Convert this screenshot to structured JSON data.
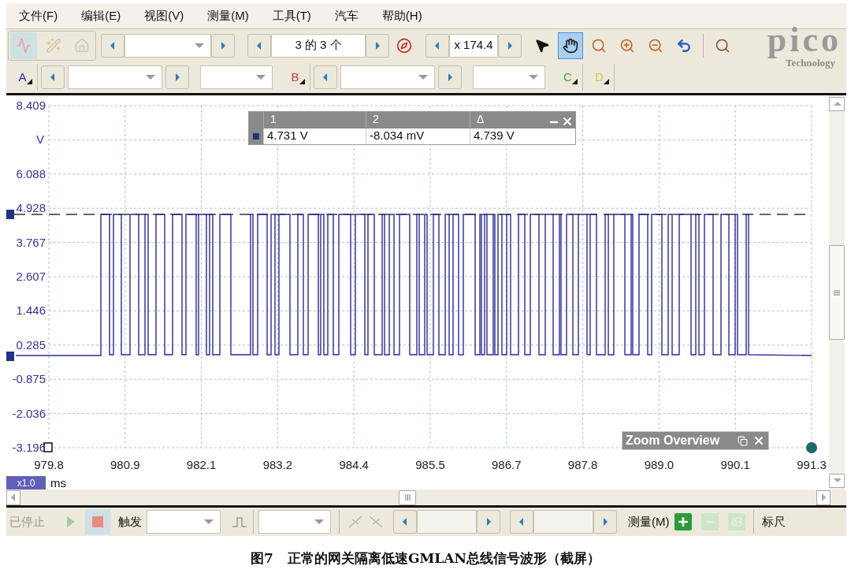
{
  "menu": [
    "文件(F)",
    "编辑(E)",
    "视图(V)",
    "测量(M)",
    "工具(T)",
    "汽车",
    "帮助(H)"
  ],
  "toolbar": {
    "page_counter": "3 的 3 个",
    "zoom_factor": "x 174.4",
    "tools": [
      {
        "kind": "pointer",
        "selected": false
      },
      {
        "kind": "hand",
        "selected": true
      },
      {
        "kind": "zoom",
        "selected": false
      },
      {
        "kind": "zoom-in",
        "selected": false
      },
      {
        "kind": "zoom-out",
        "selected": false
      },
      {
        "kind": "undo",
        "selected": false
      },
      {
        "kind": "zoom-100",
        "selected": false
      }
    ]
  },
  "logo": {
    "name": "pico",
    "tagline": "Technology"
  },
  "channels": [
    {
      "label": "A",
      "color": "#2b2ba6",
      "kind": "with-controls"
    },
    {
      "label": "B",
      "color": "#d63a3a",
      "kind": "with-controls"
    },
    {
      "label": "C",
      "color": "#3aa84a",
      "kind": "button"
    },
    {
      "label": "D",
      "color": "#d8c24a",
      "kind": "button"
    }
  ],
  "plot": {
    "y_unit": "V",
    "y_ticks": [
      "8.409",
      "6.088",
      "4.928",
      "3.767",
      "2.607",
      "1.446",
      "0.285",
      "-0.875",
      "-2.036",
      "-3.196"
    ],
    "x_ticks": [
      "979.8",
      "980.9",
      "982.1",
      "983.2",
      "984.4",
      "985.5",
      "986.7",
      "987.8",
      "989.0",
      "990.1",
      "991.3"
    ],
    "x_scale": "x1.0",
    "x_unit": "ms"
  },
  "measurements": {
    "headers": [
      "1",
      "2",
      "Δ"
    ],
    "values": [
      "4.731 V",
      "-8.034 mV",
      "4.739 V"
    ]
  },
  "zoom_overview": {
    "title": "Zoom Overview"
  },
  "bottom_bar": {
    "status": "已停止",
    "trigger_label": "触发",
    "measure_label": "测量(M)",
    "ruler_label": "标尺"
  },
  "caption": {
    "label": "图7",
    "text": "正常的网关隔离低速GMLAN总线信号波形（截屏）"
  }
}
